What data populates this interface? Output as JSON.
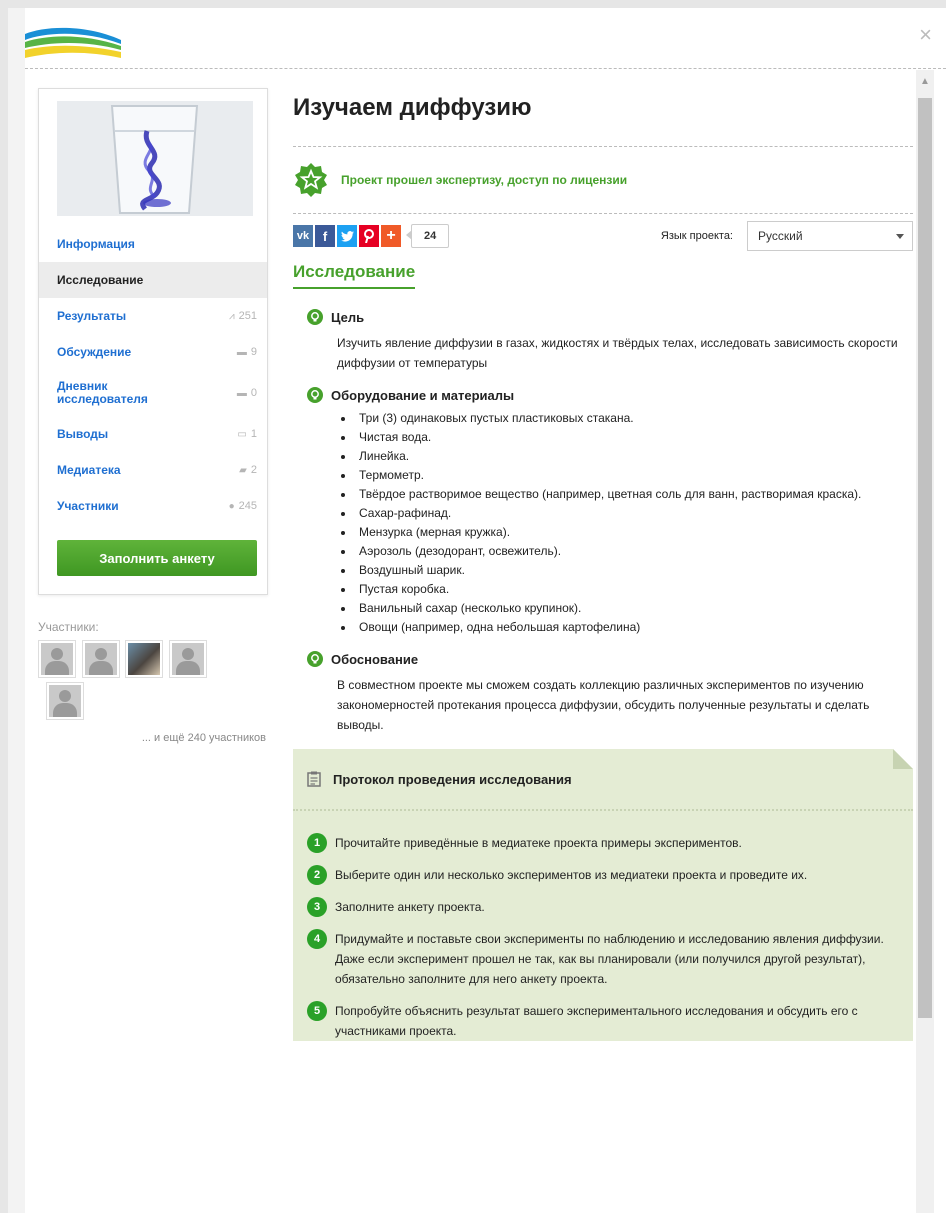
{
  "modal": {
    "close_label": "×"
  },
  "project": {
    "title": "Изучаем диффузию",
    "expertise_text": "Проект прошел экспертизу, доступ по лицензии"
  },
  "sidebar": {
    "items": [
      {
        "label": "Информация",
        "count": "",
        "icon": ""
      },
      {
        "label": "Исследование",
        "count": "",
        "icon": ""
      },
      {
        "label": "Результаты",
        "count": "251",
        "icon": "results-icon"
      },
      {
        "label": "Обсуждение",
        "count": "9",
        "icon": "comment-icon"
      },
      {
        "label": "Дневник исследователя",
        "count": "0",
        "icon": "comment-icon"
      },
      {
        "label": "Выводы",
        "count": "1",
        "icon": "conclusions-icon"
      },
      {
        "label": "Медиатека",
        "count": "2",
        "icon": "folder-icon"
      },
      {
        "label": "Участники",
        "count": "245",
        "icon": "people-icon"
      }
    ],
    "fill_button": "Заполнить анкету",
    "participants_label": "Участники:",
    "more_participants": "... и ещё 240 участников"
  },
  "share": {
    "buttons": [
      "vk",
      "f",
      "twitter",
      "pinterest",
      "+"
    ],
    "count": "24",
    "language_label": "Язык проекта:",
    "language_value": "Русский"
  },
  "section": {
    "title": "Исследование",
    "goal_title": "Цель",
    "goal_text": "Изучить явление диффузии в газах, жидкостях и твёрдых телах, исследовать зависимость скорости диффузии от температуры",
    "equipment_title": "Оборудование и материалы",
    "equipment": [
      "Три (3) одинаковых пустых пластиковых стакана.",
      "Чистая вода.",
      "Линейка.",
      "Термометр.",
      "Твёрдое растворимое вещество (например, цветная соль для ванн, растворимая краска).",
      "Сахар-рафинад.",
      "Мензурка (мерная кружка).",
      "Аэрозоль (дезодорант, освежитель).",
      "Воздушный шарик.",
      "Пустая коробка.",
      "Ванильный сахар (несколько крупинок).",
      "Овощи (например, одна небольшая картофелина)"
    ],
    "rationale_title": "Обоснование",
    "rationale_text": "В совместном проекте мы сможем создать коллекцию различных экспериментов по изучению закономерностей протекания процесса диффузии, обсудить полученные результаты и сделать выводы."
  },
  "protocol": {
    "title": "Протокол проведения исследования",
    "steps": [
      {
        "num": "1",
        "text": "Прочитайте приведённые в медиатеке проекта примеры экспериментов."
      },
      {
        "num": "2",
        "text": "Выберите один или несколько экспериментов из медиатеки проекта и проведите их."
      },
      {
        "num": "3",
        "text": "Заполните анкету проекта."
      },
      {
        "num": "4",
        "text": "Придумайте и поставьте свои эксперименты по наблюдению и исследованию явления диффузии. Даже если эксперимент прошел не так, как вы планировали (или получился другой результат), обязательно заполните для него анкету проекта."
      },
      {
        "num": "5",
        "text": "Попробуйте объяснить результат вашего экспериментального исследования и обсудить его с участниками проекта."
      }
    ]
  },
  "colors": {
    "link_blue": "#1f6fd1",
    "accent_green": "#47a12c",
    "protocol_bg": "#e4ecd4"
  }
}
